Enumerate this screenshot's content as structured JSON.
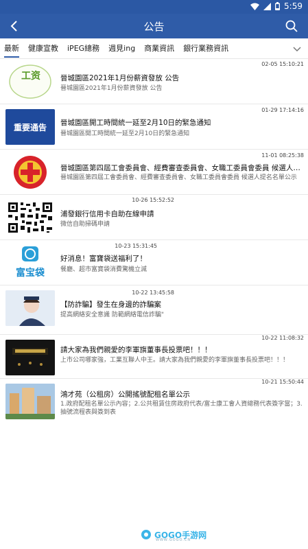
{
  "status_bar": {
    "time": "5:59"
  },
  "header": {
    "title": "公告"
  },
  "tabs": [
    {
      "label": "最新"
    },
    {
      "label": "健康宣教"
    },
    {
      "label": "iPEG總務"
    },
    {
      "label": "週見ing"
    },
    {
      "label": "商業資訊"
    },
    {
      "label": "銀行業務資訊"
    }
  ],
  "items": [
    {
      "time": "02-05 15:10:21",
      "title": "晉城園區2021年1月份薪資發放 公告",
      "summary": "晉城園區2021年1月份薪資發放 公告",
      "thumb_text": "工资"
    },
    {
      "time": "01-29 17:14:16",
      "title": "晉城園區開工時間統一延至2月10日的緊急通知",
      "summary": "晉城園區開工時間統一延至2月10日的緊急通知",
      "thumb_text": "重要通告"
    },
    {
      "time": "11-01 08:25:38",
      "title": "晉城園區第四屆工會委員會、經費審查委員會、女職工委員會委員 候選人提名...",
      "summary": "晉城園區第四屆工會委員會、經費審查委員會、女職工委員會委員 候選人提名名單公示"
    },
    {
      "time": "10-26 15:52:52",
      "title": "浦發銀行信用卡自助在線申請",
      "summary": "微信自助掃碼申請"
    },
    {
      "time": "10-23 15:31:45",
      "title": "好消息！富寶袋送福利了！",
      "summary": "餐廳、超市富寶袋消費驚機立減",
      "thumb_text": "富宝袋"
    },
    {
      "time": "10-22 13:45:58",
      "title": "【防詐騙】發生在身邊的詐騙案",
      "summary": "提高網絡安全意識 防範網絡電信詐騙\""
    },
    {
      "time": "10-22 11:08:32",
      "title": "請大家為我們親愛的李軍旗董事長投票吧！！！",
      "summary": "上市公司哪家強，工業互聯人中王。請大家為我們親愛的李軍旗董事長投票吧！！！"
    },
    {
      "time": "10-21 15:50:44",
      "title": "鴻才苑（公租房）公開搖號配租名單公示",
      "summary": "1.政府配租名單公示內容；2.公共租賃住房政府代表/富士康工會人資總務代表簽字當；3.抽號流程表與簽到表"
    }
  ],
  "watermark": {
    "text": "GOGO手游网",
    "sub": "WWW.GOGO.CN"
  }
}
